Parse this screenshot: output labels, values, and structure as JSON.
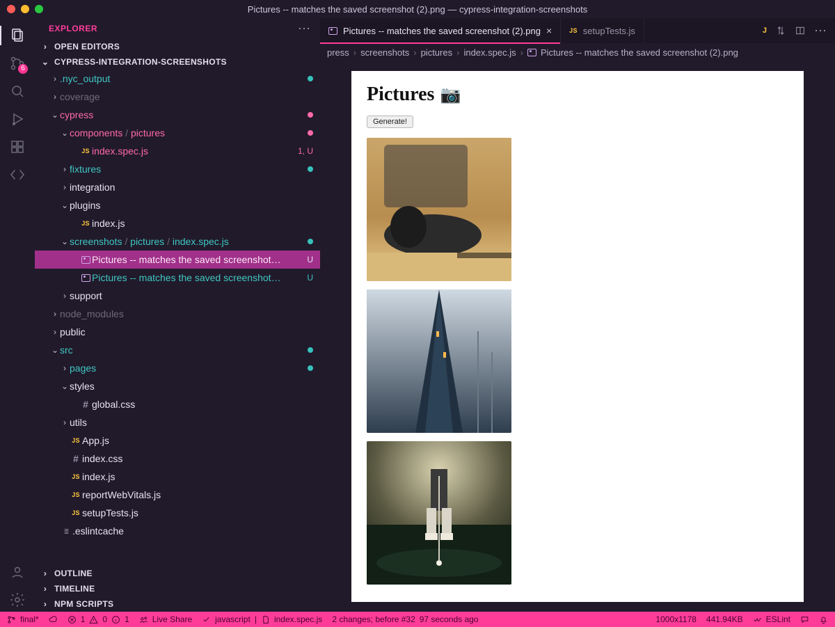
{
  "window_title": "Pictures -- matches the saved screenshot (2).png — cypress-integration-screenshots",
  "explorer_label": "EXPLORER",
  "sections": {
    "open_editors": "OPEN EDITORS",
    "project": "CYPRESS-INTEGRATION-SCREENSHOTS",
    "outline": "OUTLINE",
    "timeline": "TIMELINE",
    "npm": "NPM SCRIPTS"
  },
  "scm_badge": "6",
  "tree": [
    {
      "d": 1,
      "t": "f",
      "name": ".nyc_output",
      "cls": "c-teal",
      "open": false,
      "dot": "#36c2bc"
    },
    {
      "d": 1,
      "t": "f",
      "name": "coverage",
      "cls": "c-dim",
      "open": false
    },
    {
      "d": 1,
      "t": "f",
      "name": "cypress",
      "cls": "c-pink",
      "open": true,
      "dot": "#ff6aa8"
    },
    {
      "d": 2,
      "t": "p",
      "parts": [
        "components",
        "pictures"
      ],
      "cls": "c-pink",
      "open": true,
      "dot": "#ff6aa8"
    },
    {
      "d": 3,
      "t": "js",
      "name": "index.spec.js",
      "cls": "c-pink",
      "tail": "1, U"
    },
    {
      "d": 2,
      "t": "f",
      "name": "fixtures",
      "cls": "c-teal",
      "open": false,
      "dot": "#36c2bc"
    },
    {
      "d": 2,
      "t": "f",
      "name": "integration",
      "cls": "c-white",
      "open": false
    },
    {
      "d": 2,
      "t": "f",
      "name": "plugins",
      "cls": "c-white",
      "open": true
    },
    {
      "d": 3,
      "t": "js",
      "name": "index.js",
      "cls": "c-white"
    },
    {
      "d": 2,
      "t": "p",
      "parts": [
        "screenshots",
        "pictures",
        "index.spec.js"
      ],
      "cls": "c-teal",
      "open": true,
      "dot": "#36c2bc"
    },
    {
      "d": 3,
      "t": "img",
      "name": "Pictures -- matches the saved screenshot…",
      "cls": "c-white",
      "tail": "U",
      "sel": true
    },
    {
      "d": 3,
      "t": "img",
      "name": "Pictures -- matches the saved screenshot…",
      "cls": "c-teal",
      "tail": "U"
    },
    {
      "d": 2,
      "t": "f",
      "name": "support",
      "cls": "c-white",
      "open": false
    },
    {
      "d": 1,
      "t": "f",
      "name": "node_modules",
      "cls": "c-dim",
      "open": false
    },
    {
      "d": 1,
      "t": "f",
      "name": "public",
      "cls": "c-white",
      "open": false
    },
    {
      "d": 1,
      "t": "f",
      "name": "src",
      "cls": "c-teal",
      "open": true,
      "dot": "#36c2bc"
    },
    {
      "d": 2,
      "t": "f",
      "name": "pages",
      "cls": "c-teal",
      "open": false,
      "dot": "#36c2bc"
    },
    {
      "d": 2,
      "t": "f",
      "name": "styles",
      "cls": "c-white",
      "open": true
    },
    {
      "d": 3,
      "t": "css",
      "name": "global.css",
      "cls": "c-white"
    },
    {
      "d": 2,
      "t": "f",
      "name": "utils",
      "cls": "c-white",
      "open": false
    },
    {
      "d": 2,
      "t": "js",
      "name": "App.js",
      "cls": "c-white"
    },
    {
      "d": 2,
      "t": "css",
      "name": "index.css",
      "cls": "c-white"
    },
    {
      "d": 2,
      "t": "js",
      "name": "index.js",
      "cls": "c-white"
    },
    {
      "d": 2,
      "t": "js",
      "name": "reportWebVitals.js",
      "cls": "c-white"
    },
    {
      "d": 2,
      "t": "js",
      "name": "setupTests.js",
      "cls": "c-white"
    },
    {
      "d": 1,
      "t": "lines",
      "name": ".eslintcache",
      "cls": "c-white"
    }
  ],
  "tabs": [
    {
      "kind": "img",
      "label": "Pictures -- matches the saved screenshot (2).png",
      "active": true,
      "close": true
    },
    {
      "kind": "js",
      "label": "setupTests.js",
      "active": false
    }
  ],
  "breadcrumbs": [
    "press",
    "screenshots",
    "pictures",
    "index.spec.js",
    "Pictures -- matches the saved screenshot (2).png"
  ],
  "preview": {
    "heading": "Pictures",
    "button": "Generate!"
  },
  "status": {
    "branch": "final*",
    "errors": "1",
    "warnings": "0",
    "info": "1",
    "liveshare": "Live Share",
    "lang": "javascript",
    "file": "index.spec.js",
    "changes": "2 changes; before #32",
    "ago": "97 seconds ago",
    "dim": "1000x1178",
    "size": "441.94KB",
    "eslint": "ESLint"
  }
}
